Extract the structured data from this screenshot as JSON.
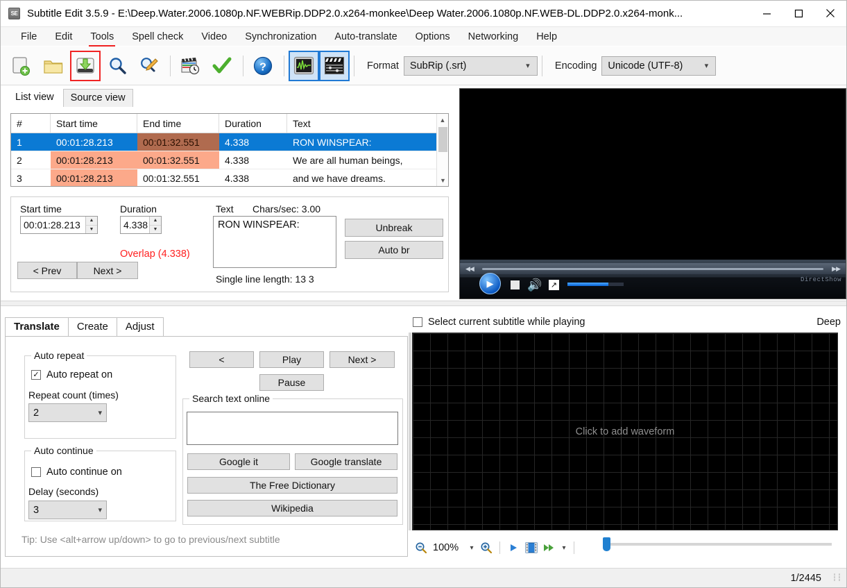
{
  "window": {
    "app_icon_label": "SE",
    "title": "Subtitle Edit 3.5.9 - E:\\Deep.Water.2006.1080p.NF.WEBRip.DDP2.0.x264-monkee\\Deep Water.2006.1080p.NF.WEB-DL.DDP2.0.x264-monk...",
    "minimize": "—",
    "maximize": "☐",
    "close": "✕"
  },
  "menu": {
    "items": [
      {
        "label": "File",
        "underlined": false
      },
      {
        "label": "Edit",
        "underlined": false
      },
      {
        "label": "Tools",
        "underlined": true
      },
      {
        "label": "Spell check",
        "underlined": false
      },
      {
        "label": "Video",
        "underlined": false
      },
      {
        "label": "Synchronization",
        "underlined": false
      },
      {
        "label": "Auto-translate",
        "underlined": false
      },
      {
        "label": "Options",
        "underlined": false
      },
      {
        "label": "Networking",
        "underlined": false
      },
      {
        "label": "Help",
        "underlined": false
      }
    ]
  },
  "toolbar": {
    "buttons": [
      {
        "icon": "new-file-icon",
        "highlight": "none"
      },
      {
        "icon": "open-folder-icon",
        "highlight": "none"
      },
      {
        "icon": "save-icon",
        "highlight": "red"
      },
      {
        "icon": "find-icon",
        "highlight": "none"
      },
      {
        "icon": "replace-icon",
        "highlight": "none"
      },
      {
        "icon": "sync-clapper-icon",
        "highlight": "none"
      },
      {
        "icon": "spellcheck-checkmark-icon",
        "highlight": "none"
      },
      {
        "icon": "help-question-icon",
        "highlight": "none"
      },
      {
        "icon": "waveform-toggle-icon",
        "highlight": "blue"
      },
      {
        "icon": "video-toggle-icon",
        "highlight": "blue"
      }
    ],
    "format_label": "Format",
    "format_value": "SubRip (.srt)",
    "encoding_label": "Encoding",
    "encoding_value": "Unicode (UTF-8)"
  },
  "view_tabs": [
    {
      "label": "List view",
      "active": true
    },
    {
      "label": "Source view",
      "active": false
    }
  ],
  "listview": {
    "columns": [
      "#",
      "Start time",
      "End time",
      "Duration",
      "Text"
    ],
    "rows": [
      {
        "num": "1",
        "start": "00:01:28.213",
        "end": "00:01:32.551",
        "duration": "4.338",
        "text": "RON WINSPEAR:",
        "selected": true,
        "start_overlap": false,
        "end_overlap": true
      },
      {
        "num": "2",
        "start": "00:01:28.213",
        "end": "00:01:32.551",
        "duration": "4.338",
        "text": "We are all human beings,",
        "selected": false,
        "start_overlap": true,
        "end_overlap": true
      },
      {
        "num": "3",
        "start": "00:01:28.213",
        "end": "00:01:32.551",
        "duration": "4.338",
        "text": "and we have dreams.",
        "selected": false,
        "start_overlap": true,
        "end_overlap": false
      }
    ]
  },
  "editpanel": {
    "start_time_label": "Start time",
    "start_time_value": "00:01:28.213",
    "duration_label": "Duration",
    "duration_value": "4.338",
    "text_label": "Text",
    "chars_per_sec": "Chars/sec: 3.00",
    "text_value": "RON WINSPEAR:",
    "overlap_warning": "Overlap (4.338)",
    "prev_button": "< Prev",
    "next_button": "Next >",
    "unbreak_button": "Unbreak",
    "autobr_button": "Auto br",
    "single_line_length": "Single line length: 13 3"
  },
  "video": {
    "play_icon": "play-icon",
    "stop_icon": "stop-icon",
    "volume_icon": "volume-icon",
    "fullscreen_icon": "fullscreen-icon",
    "rewind_icon": "rewind-icon",
    "forward_icon": "fast-forward-icon",
    "engine_label": "DirectShow"
  },
  "lower_tabs": [
    {
      "label": "Translate",
      "active": true
    },
    {
      "label": "Create",
      "active": false
    },
    {
      "label": "Adjust",
      "active": false
    }
  ],
  "translate": {
    "auto_repeat_group": "Auto repeat",
    "auto_repeat_on_label": "Auto repeat on",
    "auto_repeat_on_checked": true,
    "repeat_count_label": "Repeat count (times)",
    "repeat_count_value": "2",
    "auto_continue_group": "Auto continue",
    "auto_continue_on_label": "Auto continue on",
    "auto_continue_on_checked": false,
    "delay_label": "Delay (seconds)",
    "delay_value": "3",
    "prev_button": "<",
    "play_button": "Play",
    "next_button": "Next >",
    "pause_button": "Pause",
    "search_group": "Search text online",
    "search_value": "",
    "google_it_button": "Google it",
    "google_translate_button": "Google translate",
    "free_dictionary_button": "The Free Dictionary",
    "wikipedia_button": "Wikipedia",
    "tip": "Tip: Use <alt+arrow up/down> to go to previous/next subtitle"
  },
  "waveform": {
    "select_while_playing_label": "Select current subtitle while playing",
    "select_while_playing_checked": false,
    "right_label": "Deep",
    "placeholder": "Click to add waveform",
    "zoom_out_icon": "zoom-out-icon",
    "zoom_value": "100%",
    "zoom_in_icon": "zoom-in-icon",
    "play_icon": "play-icon",
    "scene_change_icon": "film-strip-icon",
    "playback_speed_icon": "fast-forward-icon",
    "dropdown_arrow": "chevron-down-icon"
  },
  "statusbar": {
    "position": "1/2445"
  }
}
